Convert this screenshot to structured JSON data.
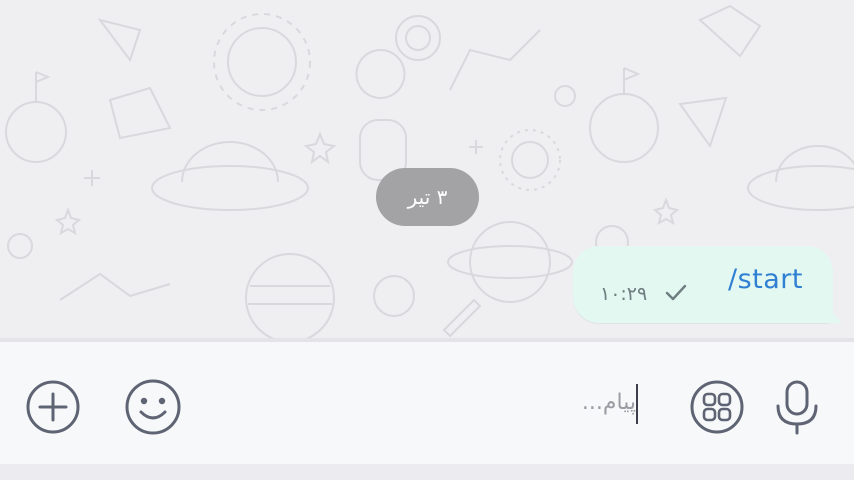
{
  "chat": {
    "date_label": "۳ تیر",
    "messages": [
      {
        "text": "/start",
        "time": "۱۰:۲۹",
        "status": "sent-check-icon"
      }
    ]
  },
  "composer": {
    "placeholder": "پیام..."
  },
  "icons": {
    "attach": "plus-circle-icon",
    "emoji": "smiley-icon",
    "apps": "grid-icon",
    "voice": "microphone-icon"
  },
  "colors": {
    "bubble_bg": "#e2f8f1",
    "message_text": "#2f7fd3",
    "icon": "#5e6473",
    "date_pill": "#a3a3a6"
  }
}
